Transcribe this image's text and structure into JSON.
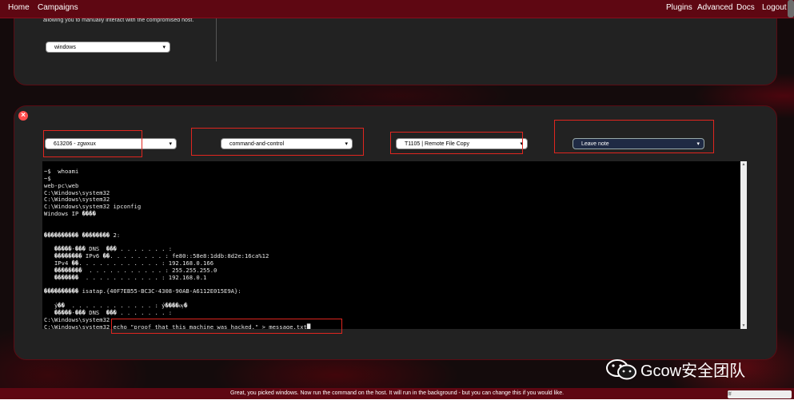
{
  "nav": {
    "left": [
      "Home",
      "Campaigns"
    ],
    "right": [
      "Plugins",
      "Advanced",
      "Docs",
      "Logout"
    ]
  },
  "panel_top": {
    "note": "allowing you to manually interact with the compromised host.",
    "os_select": "windows"
  },
  "controls": {
    "agent_select": "613206 - zgwxux",
    "tactic_select": "command-and-control",
    "technique_select": "T1105 | Remote File Copy",
    "note_select": "Leave note"
  },
  "terminal": {
    "lines": [
      "~$  whoami",
      "~$",
      "web-pc\\web",
      "C:\\Windows\\system32",
      "C:\\Windows\\system32",
      "C:\\Windows\\system32 ipconfig",
      "Windows IP ����",
      "",
      "",
      "���������� �������� 2:",
      "",
      "   �����-��� DNS  ��� . . . . . . . :",
      "   �������� IPv6 ��. . . . . . . . : fe80::58e8:1ddb:8d2e:16ca%12",
      "   IPv4 ��. . . . . . . . . . . . : 192.168.0.166",
      "   ��������  . . . . . . . . . . . : 255.255.255.0",
      "   �������  . . . . . . . . . . . : 192.168.0.1",
      "",
      "���������� isatap.{40F7EB55-BC3C-4308-90AB-A6112E015E9A}:",
      "",
      "   ý��  . . . . . . . . . . . . : ý����ѹ�",
      "   �����-��� DNS  ��� . . . . . . . :",
      "C:\\Windows\\system32",
      "C:\\Windows\\system32 echo \"proof that this machine was hacked.\" > message.txt█"
    ]
  },
  "status": "Great, you picked windows. Now run the command on the host. It will run in the background - but you can change this if you would like.",
  "watermark": "Gcow安全团队",
  "ime": "拼",
  "colors": {
    "bar": "#5e0712",
    "highlight": "#e0261f"
  }
}
